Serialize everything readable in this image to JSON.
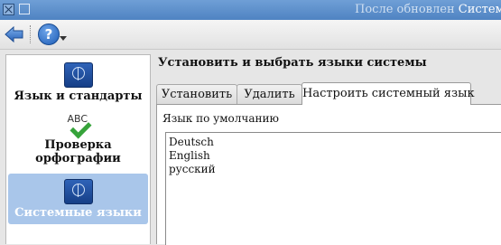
{
  "window": {
    "title_dim": "После обновлен",
    "title_bright": "Системны"
  },
  "toolbar": {
    "back_icon": "back-arrow-icon",
    "help_label": "?",
    "help_icon": "help-icon"
  },
  "sidebar": {
    "items": [
      {
        "label": "Язык и стандарты",
        "icon": "globe-flag-icon"
      },
      {
        "label": "Проверка орфографии",
        "icon": "abc-check-icon",
        "icon_text": "ABC"
      },
      {
        "label": "Системные языки",
        "icon": "globe-flag-icon",
        "selected": true
      }
    ],
    "selected_color": "#a9c6ea"
  },
  "main": {
    "title": "Установить и выбрать языки системы",
    "tabs": [
      {
        "label": "Установить"
      },
      {
        "label": "Удалить"
      },
      {
        "label": "Настроить системный язык",
        "active": true
      }
    ],
    "default_language_label": "Язык по умолчанию",
    "languages": [
      "Deutsch",
      "English",
      "русский"
    ]
  }
}
